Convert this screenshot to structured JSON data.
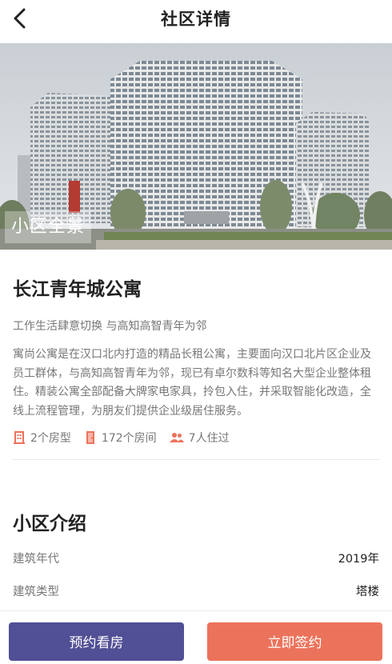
{
  "header": {
    "title": "社区详情",
    "back_icon": "chevron-left-icon"
  },
  "hero": {
    "badge": "小区全景"
  },
  "community": {
    "name": "长江青年城公寓",
    "slogan": "工作生活肆意切换 与高知高智青年为邻",
    "description": "寓尚公寓是在汉口北内打造的精品长租公寓，主要面向汉口北片区企业及员工群体，与高知高智青年为邻，现已有卓尔数科等知名大型企业整体租住。精装公寓全部配备大牌家电家具，拎包入住，并采取智能化改造，全线上流程管理，为朋友们提供企业级居住服务。",
    "stats": [
      {
        "icon": "building-icon",
        "text": "2个房型"
      },
      {
        "icon": "door-icon",
        "text": "172个房间"
      },
      {
        "icon": "people-icon",
        "text": "7人住过"
      }
    ]
  },
  "intro": {
    "title": "小区介绍",
    "rows": [
      {
        "label": "建筑年代",
        "value": "2019年"
      },
      {
        "label": "建筑类型",
        "value": "塔楼"
      }
    ]
  },
  "actions": {
    "view_label": "预约看房",
    "sign_label": "立即签约"
  },
  "colors": {
    "accent_icon": "#ec735b",
    "primary_button": "#514f95",
    "secondary_button": "#ec735b"
  }
}
